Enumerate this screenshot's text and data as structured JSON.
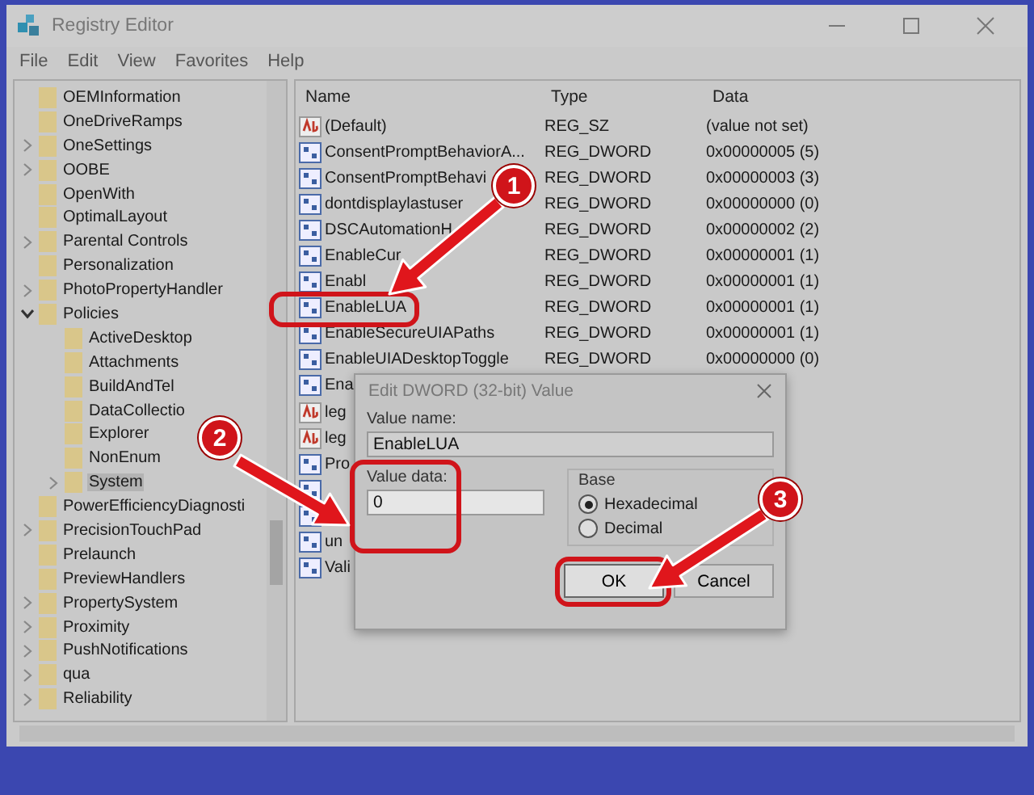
{
  "window": {
    "title": "Registry Editor"
  },
  "menu": [
    "File",
    "Edit",
    "View",
    "Favorites",
    "Help"
  ],
  "tree": [
    {
      "label": "OEMInformation",
      "expandable": false,
      "selected": false
    },
    {
      "label": "OneDriveRamps",
      "expandable": false,
      "selected": false
    },
    {
      "label": "OneSettings",
      "expandable": true,
      "expanded": false,
      "selected": false
    },
    {
      "label": "OOBE",
      "expandable": true,
      "expanded": false,
      "selected": false
    },
    {
      "label": "OpenWith",
      "expandable": false,
      "selected": false
    },
    {
      "label": "OptimalLayout",
      "expandable": false,
      "selected": false
    },
    {
      "label": "Parental Controls",
      "expandable": true,
      "expanded": false,
      "selected": false
    },
    {
      "label": "Personalization",
      "expandable": false,
      "selected": false
    },
    {
      "label": "PhotoPropertyHandler",
      "expandable": true,
      "expanded": false,
      "selected": false
    },
    {
      "label": "Policies",
      "expandable": true,
      "expanded": true,
      "selected": false,
      "children": [
        {
          "label": "ActiveDesktop",
          "expandable": false,
          "selected": false
        },
        {
          "label": "Attachments",
          "expandable": false,
          "selected": false
        },
        {
          "label": "BuildAndTel",
          "expandable": false,
          "selected": false
        },
        {
          "label": "DataCollectio",
          "expandable": false,
          "selected": false
        },
        {
          "label": "Explorer",
          "expandable": false,
          "selected": false
        },
        {
          "label": "NonEnum",
          "expandable": false,
          "selected": false
        },
        {
          "label": "System",
          "expandable": true,
          "expanded": false,
          "selected": true
        }
      ]
    },
    {
      "label": "PowerEfficiencyDiagnosti",
      "expandable": false,
      "selected": false
    },
    {
      "label": "PrecisionTouchPad",
      "expandable": true,
      "expanded": false,
      "selected": false
    },
    {
      "label": "Prelaunch",
      "expandable": false,
      "selected": false
    },
    {
      "label": "PreviewHandlers",
      "expandable": false,
      "selected": false
    },
    {
      "label": "PropertySystem",
      "expandable": true,
      "expanded": false,
      "selected": false
    },
    {
      "label": "Proximity",
      "expandable": true,
      "expanded": false,
      "selected": false
    },
    {
      "label": "PushNotifications",
      "expandable": true,
      "expanded": false,
      "selected": false
    },
    {
      "label": "qua",
      "expandable": true,
      "expanded": false,
      "selected": false
    },
    {
      "label": "Reliability",
      "expandable": true,
      "expanded": false,
      "selected": false
    }
  ],
  "list": {
    "columns": [
      "Name",
      "Type",
      "Data"
    ],
    "rows": [
      {
        "kind": "string",
        "name": "(Default)",
        "type": "REG_SZ",
        "data": "(value not set)"
      },
      {
        "kind": "dword",
        "name": "ConsentPromptBehaviorA...",
        "type": "REG_DWORD",
        "data": "0x00000005 (5)"
      },
      {
        "kind": "dword",
        "name": "ConsentPromptBehavi",
        "type": "REG_DWORD",
        "data": "0x00000003 (3)"
      },
      {
        "kind": "dword",
        "name": "dontdisplaylastuser",
        "type": "REG_DWORD",
        "data": "0x00000000 (0)"
      },
      {
        "kind": "dword",
        "name": "DSCAutomationH",
        "type": "REG_DWORD",
        "data": "0x00000002 (2)"
      },
      {
        "kind": "dword",
        "name": "EnableCur",
        "type": "REG_DWORD",
        "data": "0x00000001 (1)"
      },
      {
        "kind": "dword",
        "name": "Enabl",
        "type": "REG_DWORD",
        "data": "0x00000001 (1)"
      },
      {
        "kind": "dword",
        "name": "EnableLUA",
        "type": "REG_DWORD",
        "data": "0x00000001 (1)"
      },
      {
        "kind": "dword",
        "name": "EnableSecureUIAPaths",
        "type": "REG_DWORD",
        "data": "0x00000001 (1)"
      },
      {
        "kind": "dword",
        "name": "EnableUIADesktopToggle",
        "type": "REG_DWORD",
        "data": "0x00000000 (0)"
      },
      {
        "kind": "dword",
        "name": "Ena"
      },
      {
        "kind": "string",
        "name": "leg"
      },
      {
        "kind": "string",
        "name": "leg"
      },
      {
        "kind": "dword",
        "name": "Pro"
      },
      {
        "kind": "dword"
      },
      {
        "kind": "dword"
      },
      {
        "kind": "dword",
        "name": "un"
      },
      {
        "kind": "dword",
        "name": "Vali"
      }
    ]
  },
  "dialog": {
    "title": "Edit DWORD (32-bit) Value",
    "value_name_label": "Value name:",
    "value_name": "EnableLUA",
    "value_data_label": "Value data:",
    "value_data": "0",
    "base_label": "Base",
    "base_options": [
      {
        "label": "Hexadecimal",
        "selected": true
      },
      {
        "label": "Decimal",
        "selected": false
      }
    ],
    "buttons": [
      "OK",
      "Cancel"
    ]
  },
  "annotations": [
    {
      "number": "1"
    },
    {
      "number": "2"
    },
    {
      "number": "3"
    }
  ]
}
